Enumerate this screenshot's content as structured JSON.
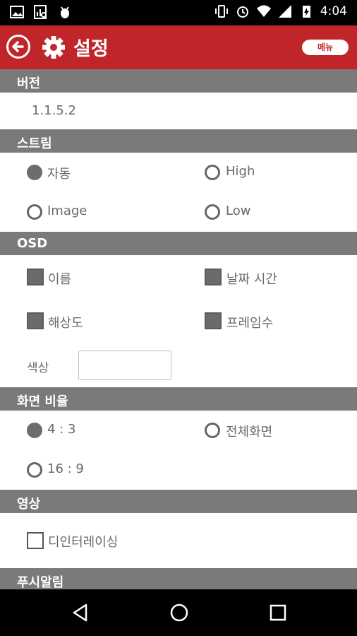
{
  "status_bar": {
    "time": "4:04"
  },
  "header": {
    "title": "설정",
    "menu_label": "메뉴"
  },
  "version": {
    "heading": "버전",
    "value": "1.1.5.2"
  },
  "stream": {
    "heading": "스트림",
    "options": [
      "자동",
      "High",
      "Image",
      "Low"
    ],
    "selected": "자동"
  },
  "osd": {
    "heading": "OSD",
    "items": [
      "이름",
      "날짜 시간",
      "해상도",
      "프레임수"
    ],
    "checked": [
      "이름",
      "날짜 시간",
      "해상도",
      "프레임수"
    ],
    "color_label": "색상"
  },
  "aspect": {
    "heading": "화면 비율",
    "options": [
      "4 : 3",
      "전체화면",
      "16 : 9"
    ],
    "selected": "4 : 3"
  },
  "video": {
    "heading": "영상",
    "deinterlace_label": "디인터레이싱",
    "deinterlace_checked": false
  },
  "push": {
    "heading": "푸시알림"
  },
  "colors": {
    "header_red": "#c0252a",
    "section_gray": "#7a7a7a"
  }
}
